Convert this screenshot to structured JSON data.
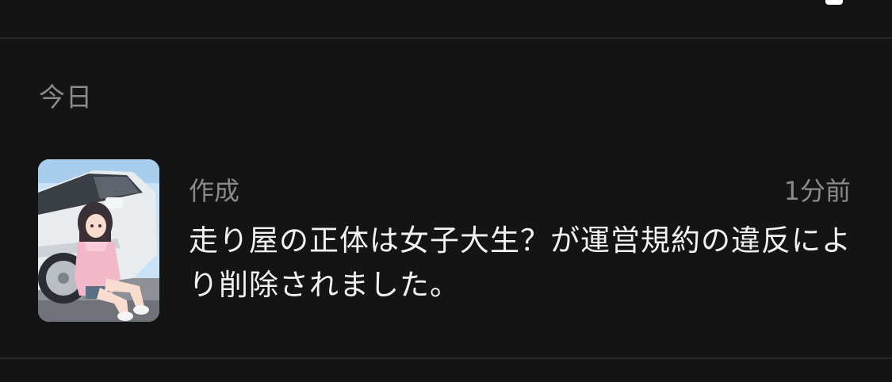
{
  "section": {
    "header": "今日"
  },
  "notifications": [
    {
      "category": "作成",
      "time": "1分前",
      "message": "走り屋の正体は女子大生？が運営規約の違反により削除されました。",
      "thumbnail_icon": "anime-girl-car-thumbnail"
    }
  ],
  "colors": {
    "background": "#141415",
    "divider": "#26262a",
    "secondary_text": "#8a8a8e",
    "primary_text": "#f2f2f2"
  }
}
